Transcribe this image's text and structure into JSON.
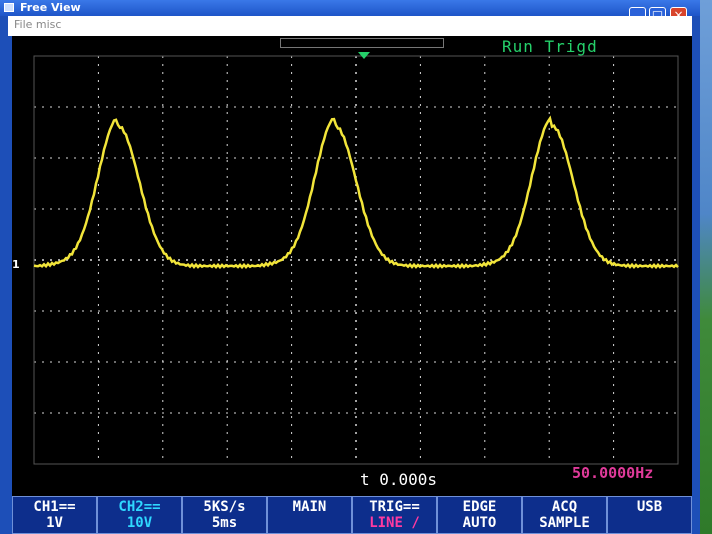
{
  "window": {
    "title": "Free View",
    "menu_text": "File   misc"
  },
  "scope": {
    "status": "Run Trigd",
    "ch1_marker": "1",
    "timebase_readout": "t 0.000s",
    "frequency_readout": "50.0000Hz",
    "trace_color": "#f2e53a",
    "grid_color": "#d8d8d8"
  },
  "softkeys": [
    {
      "line1": "CH1==",
      "line2": "1V"
    },
    {
      "line1": "CH2==",
      "line2": "10V"
    },
    {
      "line1": "5KS/s",
      "line2": "5ms"
    },
    {
      "line1": "MAIN",
      "line2": ""
    },
    {
      "line1": "TRIG==",
      "line2": "LINE /"
    },
    {
      "line1": "EDGE",
      "line2": "AUTO"
    },
    {
      "line1": "ACQ",
      "line2": "SAMPLE"
    },
    {
      "line1": "USB",
      "line2": ""
    }
  ]
}
